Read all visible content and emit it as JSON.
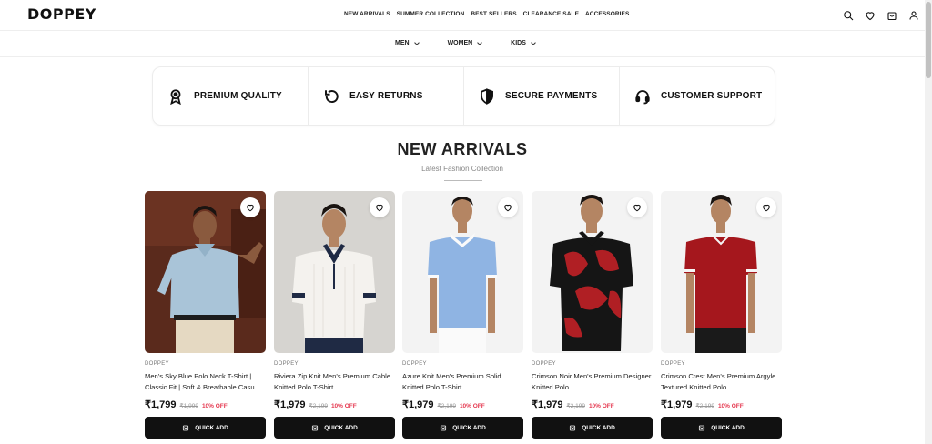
{
  "brand": {
    "logo": "DOPPEY"
  },
  "topnav": [
    "NEW ARRIVALS",
    "SUMMER COLLECTION",
    "BEST SELLERS",
    "CLEARANCE SALE",
    "ACCESSORIES"
  ],
  "header_icons": [
    "search-icon",
    "heart-icon",
    "bag-icon",
    "user-icon"
  ],
  "categories": [
    "MEN",
    "WOMEN",
    "KIDS"
  ],
  "features": [
    {
      "label": "PREMIUM QUALITY",
      "icon": "award-icon"
    },
    {
      "label": "EASY RETURNS",
      "icon": "return-icon"
    },
    {
      "label": "SECURE PAYMENTS",
      "icon": "shield-icon"
    },
    {
      "label": "CUSTOMER SUPPORT",
      "icon": "headset-icon"
    }
  ],
  "section": {
    "title": "NEW ARRIVALS",
    "subtitle": "Latest Fashion Collection"
  },
  "products": [
    {
      "brand": "DOPPEY",
      "title": "Men's Sky Blue Polo Neck T-Shirt | Classic Fit | Soft & Breathable Casu...",
      "price": "₹1,799",
      "mrp": "₹1,999",
      "discount": "10% OFF",
      "cta": "QUICK ADD"
    },
    {
      "brand": "DOPPEY",
      "title": "Riviera Zip Knit Men's Premium Cable Knitted Polo T-Shirt",
      "price": "₹1,979",
      "mrp": "₹2,199",
      "discount": "10% OFF",
      "cta": "QUICK ADD"
    },
    {
      "brand": "DOPPEY",
      "title": "Azure Knit Men's Premium Solid Knitted Polo T-Shirt",
      "price": "₹1,979",
      "mrp": "₹2,199",
      "discount": "10% OFF",
      "cta": "QUICK ADD"
    },
    {
      "brand": "DOPPEY",
      "title": "Crimson Noir Men's Premium Designer Knitted Polo",
      "price": "₹1,979",
      "mrp": "₹2,199",
      "discount": "10% OFF",
      "cta": "QUICK ADD"
    },
    {
      "brand": "DOPPEY",
      "title": "Crimson Crest Men's Premium Argyle Textured Knitted Polo",
      "price": "₹1,979",
      "mrp": "₹2,199",
      "discount": "10% OFF",
      "cta": "QUICK ADD"
    }
  ],
  "colors": {
    "accent": "#111111",
    "discount": "#e53950",
    "muted": "#999999"
  }
}
